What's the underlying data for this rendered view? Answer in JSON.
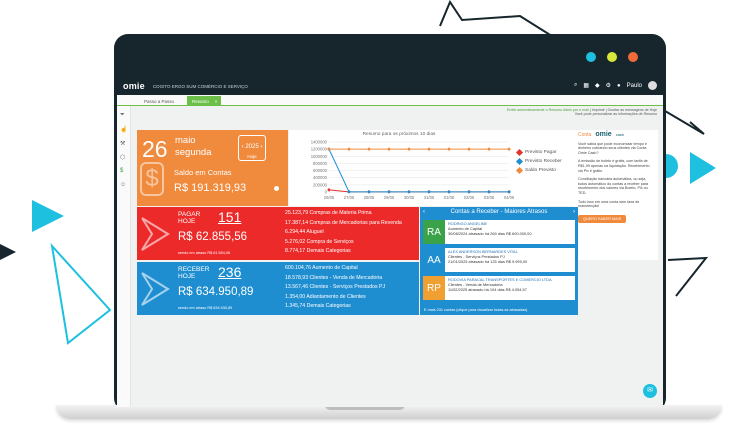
{
  "app": {
    "logo": "omie",
    "company": "COGITO ERGO SUM COMÉRCIO E SERVIÇO",
    "user": "Paulo"
  },
  "tabs": [
    {
      "label": "Passo a Passo"
    },
    {
      "label": "Resumo",
      "close": "×"
    }
  ],
  "notes": {
    "line1_green": "Emitir automaticamente o Resumo diário por e-mail",
    "line1_rest": "  |  Imprimir  |  Ocultar as mensagens de Hoje",
    "line2": "Você pode personalizar as informações de Resumo"
  },
  "date_panel": {
    "day": "26",
    "month": "maio",
    "weekday": "segunda",
    "cal_year": "2025",
    "cal_label": "Hoje",
    "cal_prev": "‹",
    "cal_next": "›",
    "balance_label": "Saldo em Contas",
    "balance_value": "R$ 191.319,93",
    "dollar_icon": "$"
  },
  "chart_data": {
    "type": "line",
    "title": "Resumo para os próximos 10 dias",
    "categories": [
      "26/05",
      "27/05",
      "28/05",
      "29/05",
      "30/05",
      "31/05",
      "01/06",
      "02/06",
      "03/06",
      "04/06"
    ],
    "ylim": [
      0,
      1400000
    ],
    "yticks": [
      "1400000",
      "1200000",
      "1000000",
      "800000",
      "600000",
      "400000",
      "200000",
      "0"
    ],
    "series": [
      {
        "name": "Previsto Pagar",
        "color": "#e0352b",
        "values": [
          60000,
          5000,
          5000,
          5000,
          5000,
          5000,
          5000,
          5000,
          5000,
          5000
        ]
      },
      {
        "name": "Previsto Receber",
        "color": "#1e8ed1",
        "values": [
          1200000,
          5000,
          5000,
          5000,
          5000,
          5000,
          5000,
          5000,
          5000,
          5000
        ]
      },
      {
        "name": "Saldo Previsto",
        "color": "#f08a3c",
        "values": [
          1200000,
          1200000,
          1200000,
          1200000,
          1200000,
          1200000,
          1200000,
          1200000,
          1200000,
          1200000
        ]
      }
    ],
    "legend": "right"
  },
  "pagar": {
    "label1": "PAGAR",
    "label2": "HOJE",
    "count": "151",
    "value": "R$ 62.855,56",
    "sub": "sendo em atraso R$ 61.554,06",
    "items": [
      "25.123,79 Compras de Materia Prima",
      "17.387,14 Compras de Mercadorias para Revenda",
      "6.294,44 Aluguel",
      "5.276,02 Compra de Serviços",
      "8.774,17 Demais Categorias"
    ]
  },
  "receber": {
    "label1": "RECEBER",
    "label2": "HOJE",
    "count": "236",
    "value": "R$ 634.950,89",
    "sub": "sendo em atraso R$ 634.930,89",
    "items": [
      "600.104,76 Aumento de Capital",
      "18.578,93 Clientes - Venda de Mercadoria",
      "13.567,46 Clientes - Serviços Prestados PJ",
      "1.354,00 Adiantamento de Clientes",
      "1.345,74 Demais Categorias"
    ]
  },
  "contas": {
    "title": "Contas a Receber - Maiores Atrasos",
    "prev": "‹",
    "next": "›",
    "rows": [
      {
        "initials": "RA",
        "color": "#3aa34a",
        "name": "RODRIGO ANGELINE",
        "cat": "Aumento de Capital",
        "info": "30/08/2024 atrasado há 269 dias R$ 600.000,00"
      },
      {
        "initials": "AA",
        "color": "#1e8ed1",
        "name": "ALEX ANDERSON BERNARDES VITAL",
        "cat": "Clientes - Serviços Prestados PJ",
        "info": "21/01/2025 atrasado há 125 dias R$ 9.999,00"
      },
      {
        "initials": "RP",
        "color": "#f0a030",
        "name": "RODOVIA PARACAL TRANSPORTES E COMERCIO LTDA",
        "cat": "Clientes - Venda de Mercadoria",
        "info": "11/02/2025 atrasado há 104 dias R$ 4.054,57"
      }
    ],
    "footer": "E mais 231 contas (clique para visualizar todas as atrasadas)"
  },
  "promo": {
    "head": "Conta",
    "brand": "omie",
    "brand_sub": "cash",
    "p1": "Você sabia que pode economizar tempo e dinheiro cobrando seus clientes via Conta Omie Cash?",
    "p2": "A emissão de boleto é grátis, com tarifa de R$1,99 apenas na liquidação. Recebimento via Pix é grátis.",
    "p3": "Conciliação bancária automática, ou seja, todos automático do contas a receber para recebimento dos valores via Boleto, Pix ou TED.",
    "p4": "Tudo isso em uma conta sem taxa de manutenção!",
    "button": "QUERO SABER MAIS"
  },
  "colors": {
    "orange": "#f08a3c",
    "red": "#ec2a2a",
    "blue": "#1e8ed1",
    "green": "#6cc04a",
    "dark": "#16262c",
    "cyan": "#1ec0e0"
  }
}
